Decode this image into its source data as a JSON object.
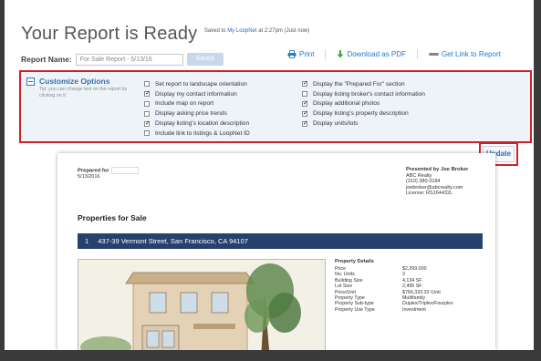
{
  "header": {
    "title": "Your Report is Ready",
    "saved_prefix": "Saved to",
    "saved_link": "My LoopNet",
    "saved_suffix": "at 2:27pm (Just now)"
  },
  "report_name": {
    "label": "Report Name:",
    "value": "For Sale Report - 5/13/16",
    "save_label": "Saved"
  },
  "actions": {
    "print": "Print",
    "download": "Download as PDF",
    "link": "Get Link to Report"
  },
  "customize": {
    "title": "Customize Options",
    "tip": "Tip: you can change text on the report by clicking on it",
    "update_label": "Update",
    "left_options": [
      {
        "label": "Set report to landscape orientation",
        "checked": false
      },
      {
        "label": "Display my contact information",
        "checked": true
      },
      {
        "label": "Include map on report",
        "checked": false
      },
      {
        "label": "Display asking price trends",
        "checked": false
      },
      {
        "label": "Display listing's location description",
        "checked": true
      },
      {
        "label": "Include link to listings & LoopNet ID",
        "checked": false
      }
    ],
    "right_options": [
      {
        "label": "Display the \"Prepared For\" section",
        "checked": true
      },
      {
        "label": "Display listing broker's contact information",
        "checked": false
      },
      {
        "label": "Display additional photos",
        "checked": true
      },
      {
        "label": "Display listing's property description",
        "checked": true
      },
      {
        "label": "Display units/lots",
        "checked": true
      }
    ]
  },
  "preview": {
    "prepared_for_label": "Prepared for",
    "prepared_date": "5/13/2016",
    "presented_by": "Presented by Joe Broker",
    "company": "ABC Realty",
    "phone": "(310) 380-3184",
    "email": "joebroker@abcrealty.com",
    "license": "License: RS164432L",
    "section_title": "Properties for Sale",
    "property_number": "1",
    "property_address": "437-39 Vermont Street, San Francisco, CA 94107",
    "details_title": "Property Details",
    "details": [
      {
        "label": "Price",
        "value": "$2,299,000"
      },
      {
        "label": "No. Units",
        "value": "3"
      },
      {
        "label": "Building Size",
        "value": "4,134 SF"
      },
      {
        "label": "Lot Size",
        "value": "2,495 SF"
      },
      {
        "label": "Price/Unit",
        "value": "$766,333.33 /Unit"
      },
      {
        "label": "Property Type",
        "value": "Multifamily"
      },
      {
        "label": "Property Sub-type",
        "value": "Duplex/Triplex/Fourplex"
      },
      {
        "label": "Property Use Type",
        "value": "Investment"
      }
    ]
  },
  "colors": {
    "accent": "#2a78c8",
    "highlight_border": "#d21f26",
    "property_bar": "#26416e",
    "options_bg": "#eef3fa"
  }
}
